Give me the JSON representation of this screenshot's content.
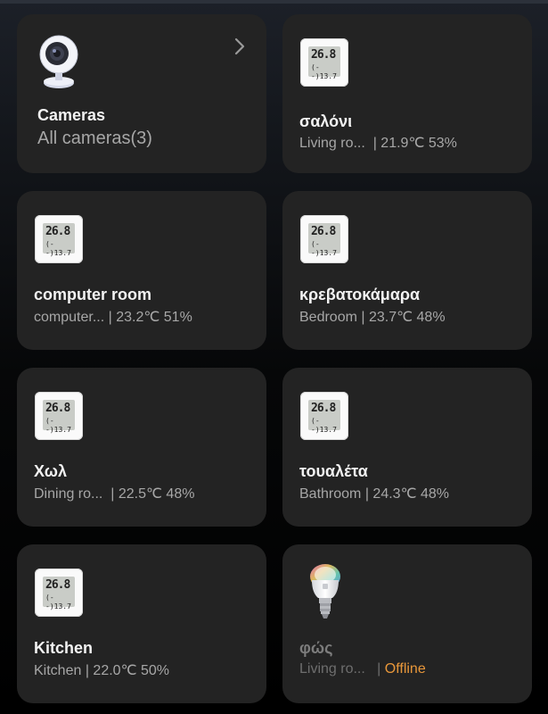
{
  "cards": [
    {
      "title": "Cameras",
      "subtitle": "All cameras(3)",
      "icon": "camera-icon"
    },
    {
      "title": "σαλόνι",
      "room": "Living ro...",
      "reading": "| 21.9℃ 53%",
      "icon": "thermometer-icon"
    },
    {
      "title": "computer room",
      "room": "computer...",
      "reading": "| 23.2℃ 51%",
      "icon": "thermometer-icon"
    },
    {
      "title": "κρεβατοκάμαρα",
      "room": "Bedroom",
      "reading": "| 23.7℃ 48%",
      "icon": "thermometer-icon"
    },
    {
      "title": "Χωλ",
      "room": "Dining ro...",
      "reading": "| 22.5℃ 48%",
      "icon": "thermometer-icon"
    },
    {
      "title": "τουαλέτα",
      "room": "Bathroom",
      "reading": "| 24.3℃ 48%",
      "icon": "thermometer-icon"
    },
    {
      "title": "Kitchen",
      "room": "Kitchen",
      "reading": "| 22.0℃ 50%",
      "icon": "thermometer-icon"
    },
    {
      "title": "φώς",
      "room": "Living ro...",
      "reading": "|",
      "status": "Offline",
      "icon": "bulb-icon"
    }
  ],
  "thermo_display": {
    "line1": "26.8",
    "line2": "(--)13.7"
  },
  "colors": {
    "card": "#232323",
    "offline": "#e8973a",
    "title": "#f2f2f2",
    "subtitle": "#a7a7a7"
  }
}
